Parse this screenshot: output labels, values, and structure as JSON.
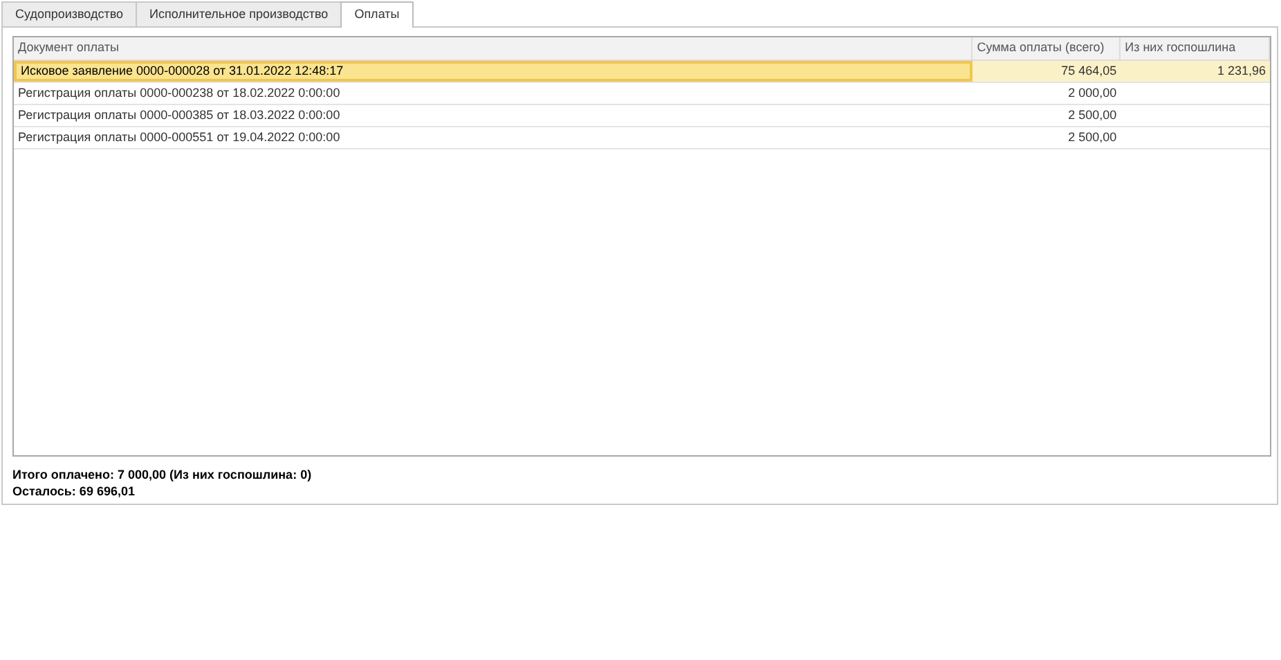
{
  "tabs": [
    {
      "label": "Судопроизводство",
      "selected": false
    },
    {
      "label": "Исполнительное производство",
      "selected": false
    },
    {
      "label": "Оплаты",
      "selected": true
    }
  ],
  "table": {
    "columns": [
      "Документ оплаты",
      "Сумма оплаты (всего)",
      "Из них госпошлина"
    ],
    "rows": [
      {
        "cells": [
          "Исковое заявление 0000-000028 от 31.01.2022 12:48:17",
          "75 464,05",
          "1 231,96"
        ],
        "selected": true
      },
      {
        "cells": [
          "Регистрация оплаты 0000-000238 от 18.02.2022 0:00:00",
          "2 000,00"
        ],
        "selected": false
      },
      {
        "cells": [
          "Регистрация оплаты 0000-000385 от 18.03.2022 0:00:00",
          "2 500,00"
        ],
        "selected": false
      },
      {
        "cells": [
          "Регистрация оплаты 0000-000551 от 19.04.2022 0:00:00",
          "2 500,00"
        ],
        "selected": false
      }
    ]
  },
  "summary": [
    "Итого оплачено: 7 000,00 (Из них госпошлина: 0)",
    "Осталось: 69 696,01"
  ]
}
